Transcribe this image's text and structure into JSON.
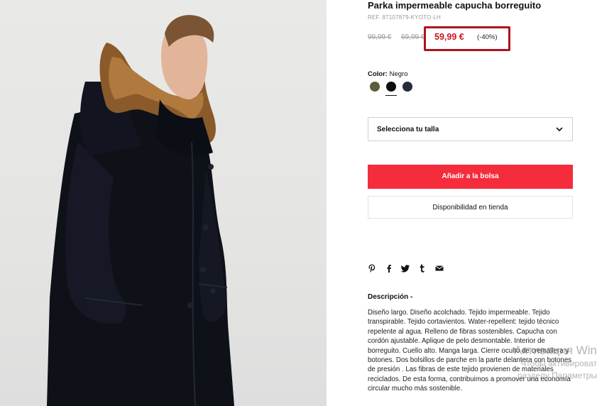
{
  "product": {
    "title": "Parka impermeable capucha borreguito",
    "ref": "REF. 87107879-KYOTO-LH",
    "old_prices": [
      "99,99 €",
      "69,99 €"
    ],
    "price": "59,99 €",
    "discount": "(-40%)"
  },
  "color": {
    "label": "Color:",
    "selected": "Negro",
    "swatches": [
      {
        "name": "olive-swatch",
        "hex": "#5e5e3e"
      },
      {
        "name": "black-swatch",
        "hex": "#0d0d0d"
      },
      {
        "name": "navy-swatch",
        "hex": "#262b3f"
      }
    ]
  },
  "size_select": {
    "placeholder": "Selecciona tu talla",
    "icon": "chevron-down-icon"
  },
  "buttons": {
    "add_to_bag": "Añadir a la bolsa",
    "store_availability": "Disponibilidad en tienda"
  },
  "share_icons": [
    "pinterest-icon",
    "facebook-icon",
    "twitter-icon",
    "tumblr-icon",
    "email-icon"
  ],
  "description": {
    "heading": "Descripción -",
    "body": "Diseño largo. Diseño acolchado. Tejido impermeable. Tejido transpirable. Tejido cortavientos. Water-repellent: tejido técnico repelente al agua. Relleno de fibras sostenibles. Capucha con cordón ajustable. Aplique de pelo desmontable. Interior de borreguito. Cuello alto. Manga larga. Cierre oculto de cremallera y botones. Dos bolsillos de parche en la parte delantera con botones de presión . Las fibras de este tejido provienen de materiales reciclados. De esta forma, contribuimos a promover una economía circular mucho más sostenible."
  },
  "watermark": {
    "line1": "Активация Win",
    "line2": "Чтобы активироват",
    "line3": "разделу Параметры"
  },
  "colors": {
    "accent_red": "#f42c3c",
    "price_red": "#d0121f",
    "highlight_border": "#b0121b"
  }
}
